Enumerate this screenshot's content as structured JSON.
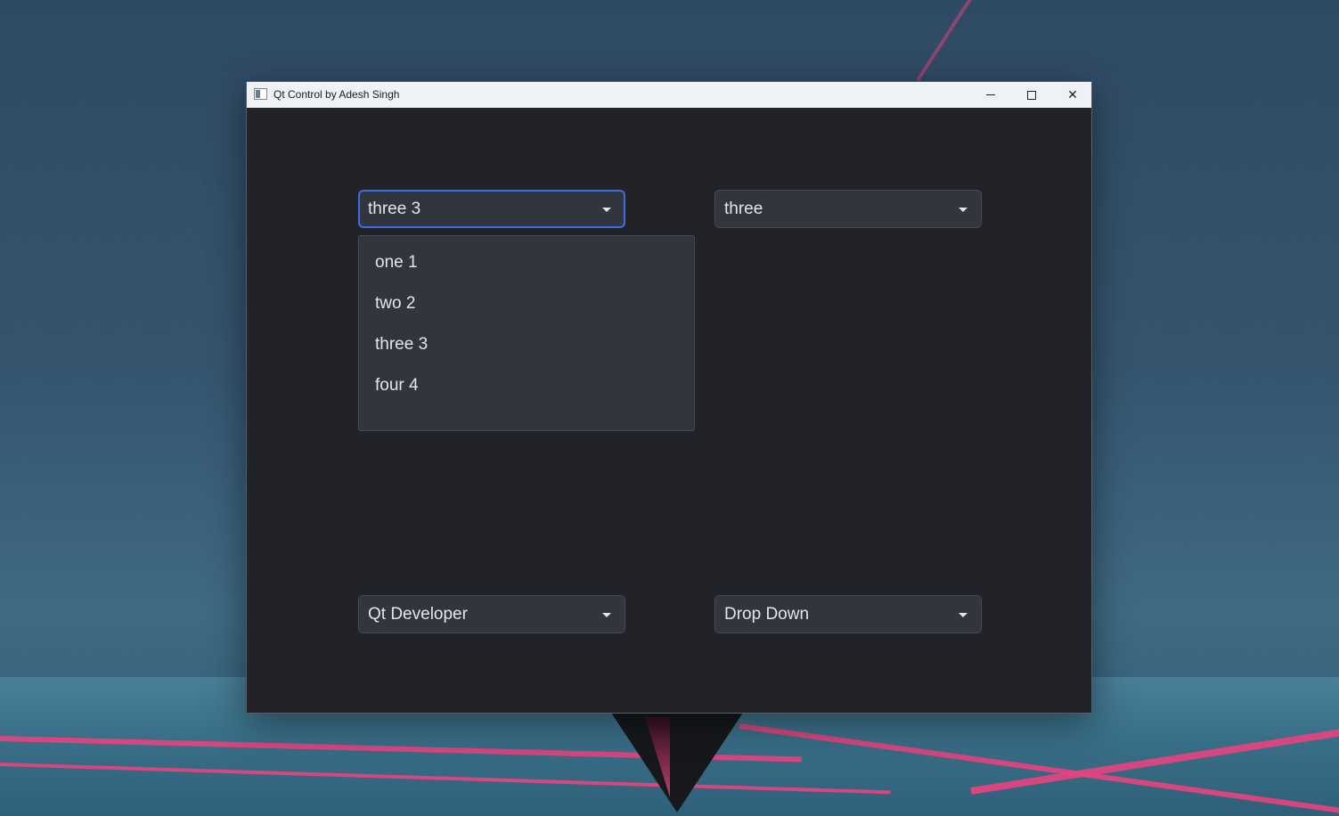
{
  "window": {
    "title": "Qt Control by Adesh Singh"
  },
  "combos": {
    "top_left": {
      "value": "three 3",
      "focused": true,
      "open": true
    },
    "top_right": {
      "value": "three"
    },
    "bottom_left": {
      "value": "Qt Developer"
    },
    "bottom_right": {
      "value": "Drop Down"
    }
  },
  "popup": {
    "items": [
      "one 1",
      "two 2",
      "three 3",
      "four 4"
    ]
  },
  "colors": {
    "window_bg": "#222328",
    "combo_bg": "#33353e",
    "focus_border": "#3d6ee0",
    "text": "#e6e6e9"
  },
  "icons": {
    "app": "app-icon",
    "minimize": "minimize-icon",
    "maximize": "maximize-icon",
    "close": "close-icon",
    "dropdown": "chevron-down-icon"
  }
}
